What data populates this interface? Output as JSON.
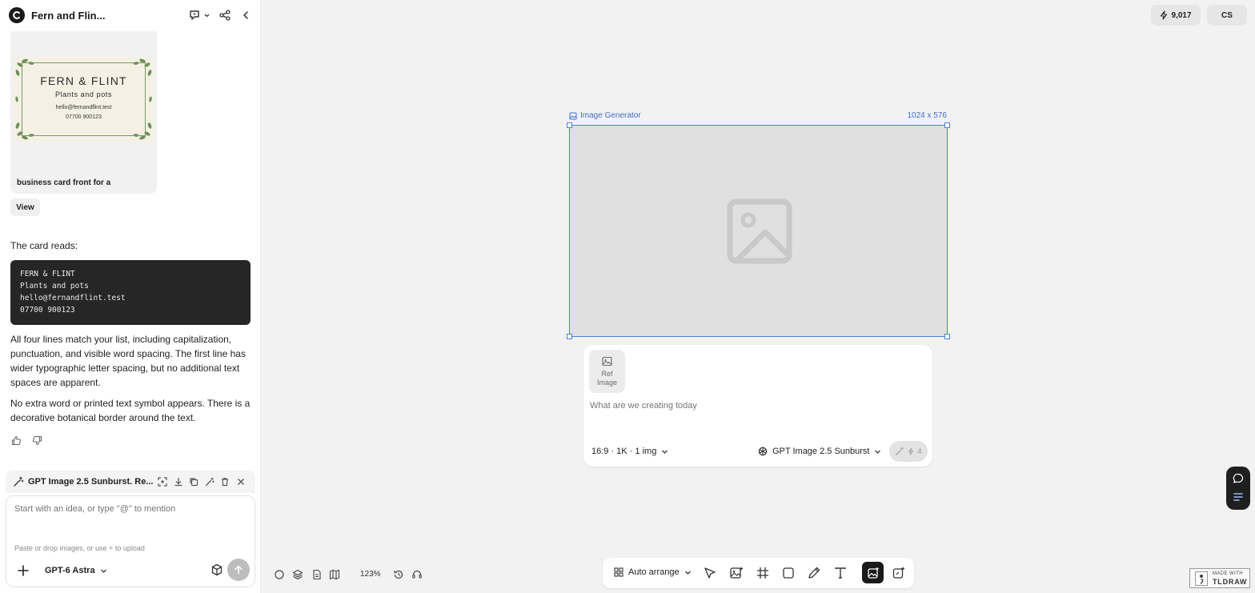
{
  "left_panel": {
    "title": "Fern and Flin...",
    "thumbnail": {
      "card_name": "FERN & FLINT",
      "card_tagline": "Plants and pots",
      "card_email": "hello@fernandflint.test",
      "card_phone": "07700 900123",
      "caption": "business card front for a"
    },
    "view_label": "View",
    "intro": "The card reads:",
    "code_lines": [
      "FERN & FLINT",
      "Plants and pots",
      "hello@fernandflint.test",
      "07700 900123"
    ],
    "paragraph_1": "All four lines match your list, including capitalization, punctuation, and visible word spacing. The first line has wider typographic letter spacing, but no additional text spaces are apparent.",
    "paragraph_2": "No extra word or printed text symbol appears. There is a decorative botanical border around the text.",
    "task": {
      "title": "GPT Image 2.5 Sunburst. Re..."
    },
    "composer": {
      "placeholder": "Start with an idea, or type \"@\" to mention",
      "hint": "Paste or drop images, or use + to upload",
      "model": "GPT-6 Astra"
    }
  },
  "top_right": {
    "credits": "9,017",
    "user_initials": "CS"
  },
  "frame": {
    "label": "Image Generator",
    "dims": "1024 x 576"
  },
  "generator": {
    "ref_label_1": "Ref",
    "ref_label_2": "Image",
    "placeholder": "What are we creating today",
    "options": "16:9 · 1K · 1 img",
    "model": "GPT Image 2.5 Sunburst",
    "cost": "4"
  },
  "bottom": {
    "zoom": "123%",
    "auto_arrange": "Auto arrange"
  },
  "badge": {
    "line1": "MADE WITH",
    "line2": "TLDRAW"
  },
  "colors": {
    "accent": "#4a7fdc",
    "dark": "#1a1a1a",
    "canvas": "#f2f2f2"
  }
}
